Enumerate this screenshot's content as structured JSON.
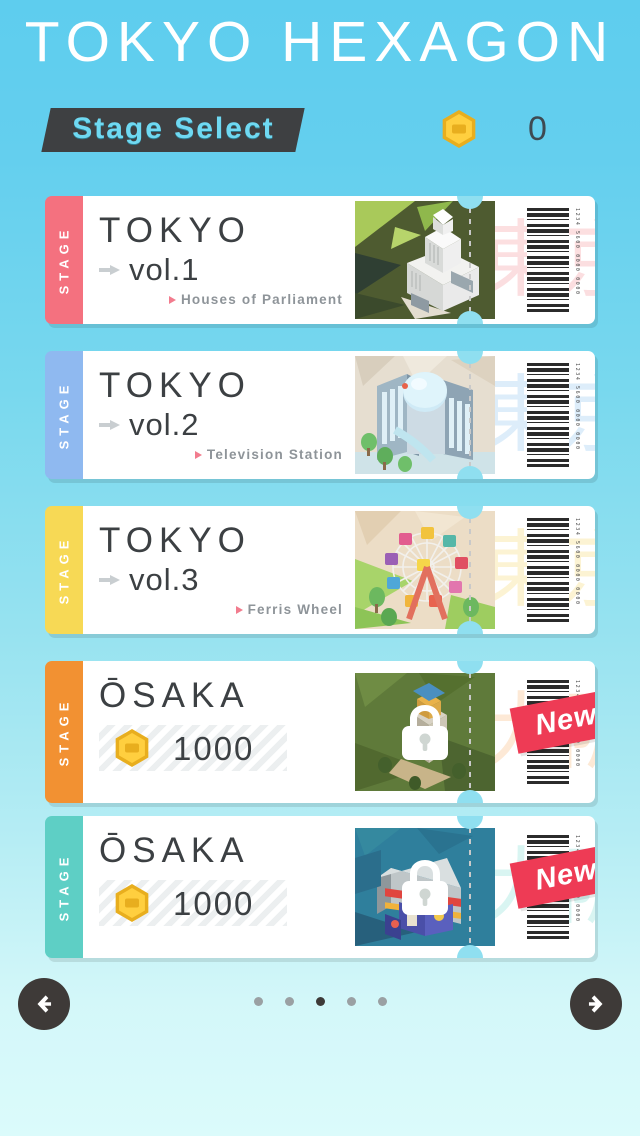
{
  "header": {
    "app_title": "TOKYO HEXAGON",
    "banner_label": "Stage Select",
    "coin_icon": "hexagon-coin-icon",
    "coin_amount": "0"
  },
  "colors": {
    "bg_top": "#5ecdee",
    "bg_bottom": "#dbfbfb",
    "banner_bg": "#3e4042",
    "banner_text": "#6fd9f2",
    "coin_gold": "#ffcf3f",
    "new_badge": "#ee3b55",
    "nav_button": "#3e3a38"
  },
  "tickets": [
    {
      "stage_label": "STAGE",
      "tab_color": "#f4717f",
      "city": "TOKYO",
      "volume": "vol.1",
      "subtitle": "Houses of Parliament",
      "kanji": "東京",
      "kanji_color": "#f9bfc2",
      "thumb_name": "houses-of-parliament-thumbnail",
      "locked": false,
      "new": false,
      "barcode_digits": "1234 5600 0000 0000"
    },
    {
      "stage_label": "STAGE",
      "tab_color": "#8fb9f0",
      "city": "TOKYO",
      "volume": "vol.2",
      "subtitle": "Television Station",
      "kanji": "東京",
      "kanji_color": "#bcdcf7",
      "thumb_name": "television-station-thumbnail",
      "locked": false,
      "new": false,
      "barcode_digits": "1234 5600 0000 0000"
    },
    {
      "stage_label": "STAGE",
      "tab_color": "#f7d955",
      "city": "TOKYO",
      "volume": "vol.3",
      "subtitle": "Ferris Wheel",
      "kanji": "東京",
      "kanji_color": "#fbe9a8",
      "thumb_name": "ferris-wheel-thumbnail",
      "locked": false,
      "new": false,
      "barcode_digits": "1234 5600 0000 0000"
    },
    {
      "stage_label": "STAGE",
      "tab_color": "#f29132",
      "city": "ŌSAKA",
      "price": "1000",
      "price_icon": "hexagon-coin-icon",
      "kanji": "大阪",
      "kanji_color": "#fbd4ad",
      "thumb_name": "osaka-castle-thumbnail",
      "locked": true,
      "new": true,
      "new_label": "New!",
      "barcode_digits": "1234 5600 0000 0000"
    },
    {
      "stage_label": "STAGE",
      "tab_color": "#5ecfc5",
      "city": "ŌSAKA",
      "price": "1000",
      "price_icon": "hexagon-coin-icon",
      "kanji": "大阪",
      "kanji_color": "#b4ece6",
      "thumb_name": "dotonbori-thumbnail",
      "locked": true,
      "new": true,
      "new_label": "New!",
      "barcode_digits": "1234 5600 0000 0000"
    }
  ],
  "bottom_nav": {
    "prev_icon": "arrow-left-icon",
    "next_icon": "arrow-right-icon",
    "page_count": 5,
    "active_page": 3
  }
}
